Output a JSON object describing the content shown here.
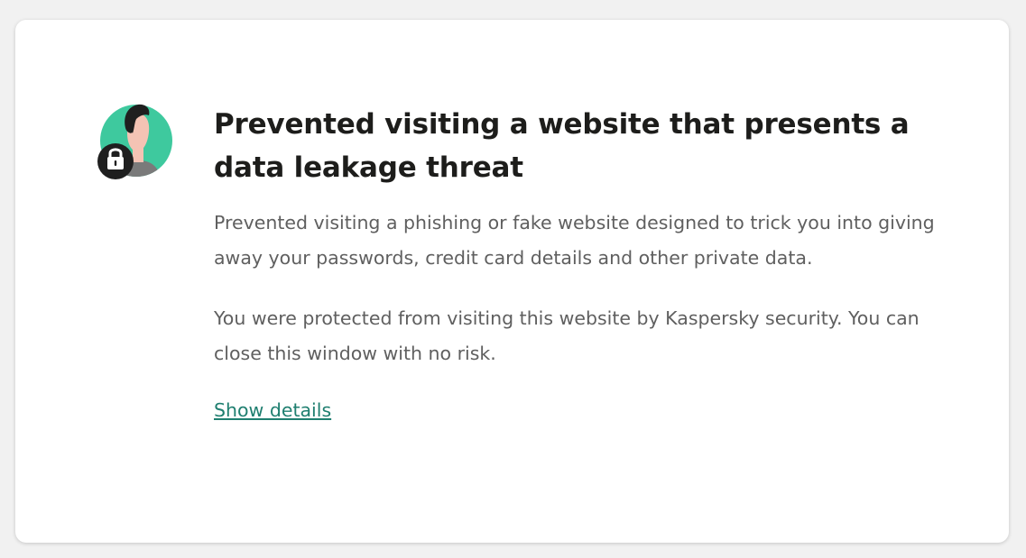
{
  "dialog": {
    "title": "Prevented visiting a website that presents a data leakage threat",
    "description": "Prevented visiting a phishing or fake website designed to trick you into giving away your passwords, credit card details and other private data.",
    "protection_note": "You were protected from visiting this website by Kaspersky security. You can close this window with no risk.",
    "show_details_label": "Show details"
  },
  "icon": {
    "name": "user-lock-icon",
    "colors": {
      "background_circle": "#3ec99e",
      "hair": "#1f1f1f",
      "skin": "#f4c3b4",
      "shirt": "#7a7a7a",
      "lock_badge": "#1f1f1f",
      "lock_shackle": "#ffffff"
    }
  },
  "theme": {
    "page_background": "#f1f1f1",
    "card_background": "#ffffff",
    "title_color": "#1d1d1b",
    "text_color": "#5f5f5f",
    "link_color": "#1f7f70"
  }
}
